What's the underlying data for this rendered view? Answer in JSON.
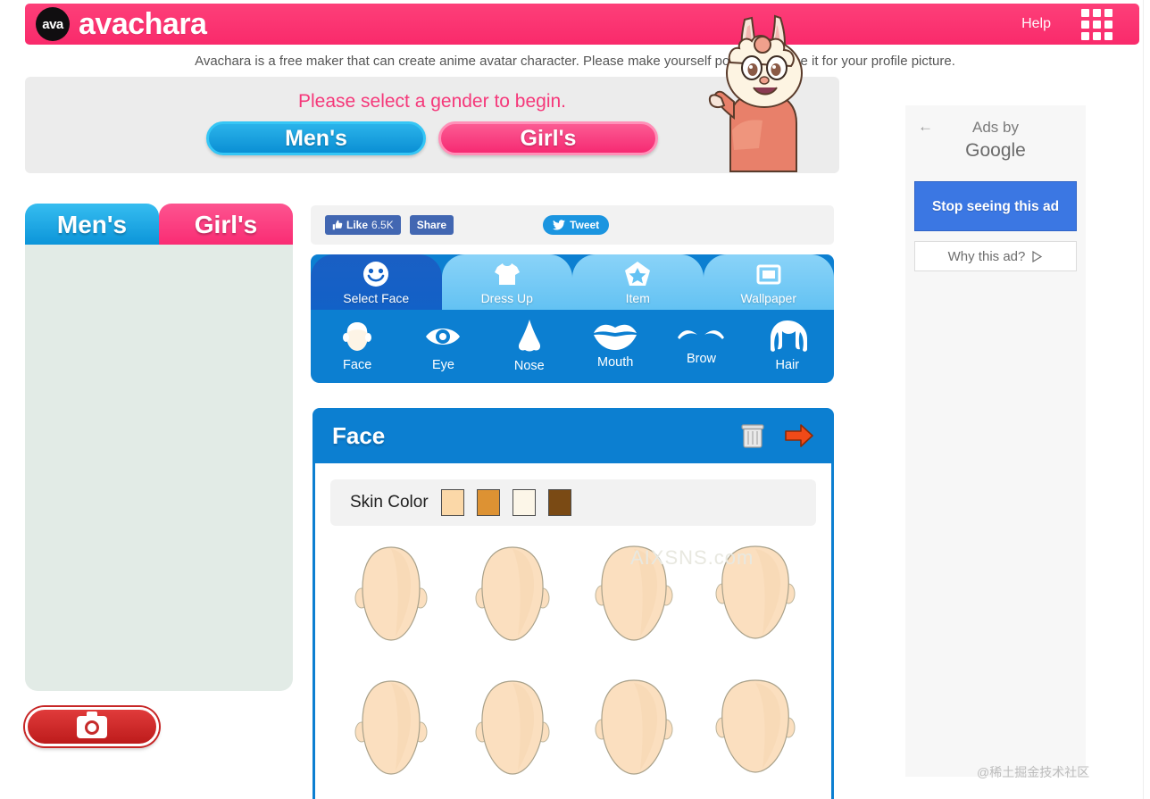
{
  "header": {
    "logo_badge": "ava",
    "logo_text": "avachara",
    "help_label": "Help",
    "menu_icon": "grid-menu-icon",
    "bg_color": "#fa3372"
  },
  "description": "Avachara is a free maker that can create anime avatar character. Please make yourself portrait and use it for your profile picture.",
  "gender_panel": {
    "title": "Please select a gender to begin.",
    "buttons": [
      {
        "label": "Men's",
        "color": "#0a8fd4"
      },
      {
        "label": "Girl's",
        "color": "#f62a72"
      }
    ],
    "mascot_icon": "rabbit-mascot-icon"
  },
  "sidebar": {
    "tabs": [
      {
        "label": "Men's",
        "color": "#0a93d8"
      },
      {
        "label": "Girl's",
        "color": "#f92a72"
      }
    ],
    "preview_bg": "#e2ebe6",
    "camera_button_icon": "camera-icon",
    "camera_button_color": "#bd1b1b"
  },
  "social": {
    "like_label": "Like",
    "like_count": "6.5K",
    "share_label": "Share",
    "tweet_label": "Tweet",
    "facebook_color": "#4267b2",
    "twitter_color": "#1b95e0"
  },
  "main_tabs": {
    "items": [
      {
        "label": "Select Face",
        "icon": "smiley-face-icon",
        "active": true
      },
      {
        "label": "Dress Up",
        "icon": "tshirt-icon",
        "active": false
      },
      {
        "label": "Item",
        "icon": "star-icon",
        "active": false
      },
      {
        "label": "Wallpaper",
        "icon": "square-frame-icon",
        "active": false
      }
    ],
    "active_color": "#1261c7",
    "inactive_color": "#63c2f3"
  },
  "sub_tabs": {
    "items": [
      {
        "label": "Face",
        "icon": "head-outline-icon"
      },
      {
        "label": "Eye",
        "icon": "eye-icon"
      },
      {
        "label": "Nose",
        "icon": "nose-icon"
      },
      {
        "label": "Mouth",
        "icon": "mouth-lips-icon"
      },
      {
        "label": "Brow",
        "icon": "eyebrow-icon"
      },
      {
        "label": "Hair",
        "icon": "hair-icon"
      }
    ],
    "bg_color": "#0c7fd1"
  },
  "face_panel": {
    "title": "Face",
    "delete_icon": "trash-icon",
    "next_icon": "orange-right-arrow-icon",
    "skin_color_label": "Skin Color",
    "skin_colors": [
      "#fbd8a8",
      "#dd9233",
      "#fcf6e8",
      "#7a4a14"
    ],
    "face_options_row1": [
      "face-oval-1",
      "face-oval-2",
      "face-round-3",
      "face-round-4"
    ],
    "face_options_row2": [
      "face-oval-5",
      "face-oval-6",
      "face-round-7",
      "face-round-8"
    ],
    "face_skin_fill": "#fbdfbf",
    "header_color": "#0c7fd1"
  },
  "ads": {
    "back_icon": "back-arrow-icon",
    "ads_by": "Ads by",
    "provider": "Google",
    "stop_label": "Stop seeing this ad",
    "why_label": "Why this ad?",
    "why_icon": "play-triangle-icon",
    "stop_color": "#3b77e3"
  },
  "watermarks": {
    "center": "AIXSNS.com",
    "corner": "@稀土掘金技术社区"
  }
}
